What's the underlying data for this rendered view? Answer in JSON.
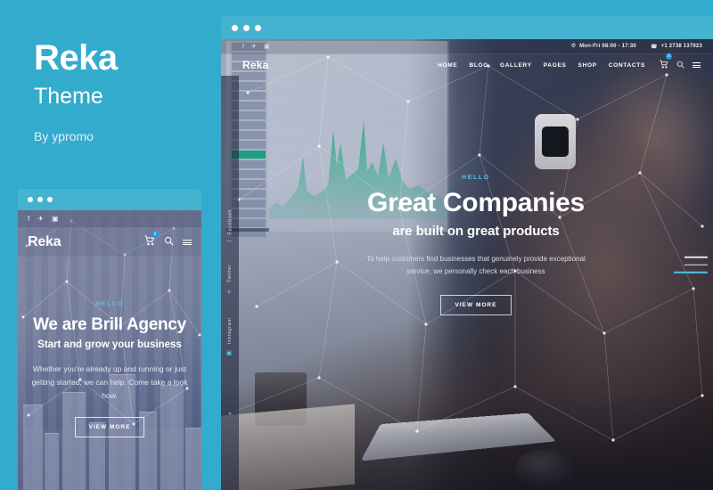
{
  "brand": {
    "title": "Reka",
    "subtitle": "Theme",
    "author": "By ypromo",
    "accent_color": "#33abcc",
    "chrome_color": "#45b3cf",
    "highlight_color": "#4fc3e8"
  },
  "desktop": {
    "window_dots": [
      "dot",
      "dot",
      "dot"
    ],
    "topbar": {
      "socials": [
        {
          "name": "facebook-icon",
          "glyph": "f"
        },
        {
          "name": "twitter-icon",
          "glyph": "✈"
        },
        {
          "name": "instagram-icon",
          "glyph": "▣"
        }
      ],
      "hours_icon": "clock-icon",
      "hours": "Mon-Fri 08:00 - 17:30",
      "phone_icon": "phone-icon",
      "phone": "+1 2738 137923"
    },
    "logo": "Reka",
    "menu": [
      "HOME",
      "BLOG",
      "GALLERY",
      "PAGES",
      "SHOP",
      "CONTACTS"
    ],
    "tools": {
      "cart_icon": "cart-icon",
      "cart_count": "0",
      "search_icon": "search-icon",
      "menu_icon": "hamburger-icon"
    },
    "rail": [
      {
        "label": "Facebook",
        "icon": "facebook-icon",
        "glyph": "f"
      },
      {
        "label": "Twitter",
        "icon": "twitter-icon",
        "glyph": "✈"
      },
      {
        "label": "Instagram",
        "icon": "instagram-icon",
        "glyph": "▣"
      }
    ],
    "hero": {
      "eyebrow": "HELLO",
      "title": "Great Companies",
      "subtitle": "are built on great products",
      "lead": "To help customers find businesses that genuinely provide exceptional service, we personally check each business",
      "cta": "VIEW MORE"
    }
  },
  "tablet": {
    "window_dots": [
      "dot",
      "dot",
      "dot"
    ],
    "socials": [
      {
        "name": "facebook-icon",
        "glyph": "f"
      },
      {
        "name": "twitter-icon",
        "glyph": "✈"
      },
      {
        "name": "instagram-icon",
        "glyph": "▣"
      }
    ],
    "logo": "Reka",
    "tools": {
      "cart_icon": "cart-icon",
      "cart_count": "0",
      "search_icon": "search-icon",
      "menu_icon": "hamburger-icon"
    },
    "hero": {
      "eyebrow": "HELLO",
      "title": "We are Brill Agency",
      "subtitle": "Start and grow your business",
      "lead": "Whether you're already up and running or just getting started, we can help. Come take a look how.",
      "cta": "VIEW MORE"
    }
  }
}
